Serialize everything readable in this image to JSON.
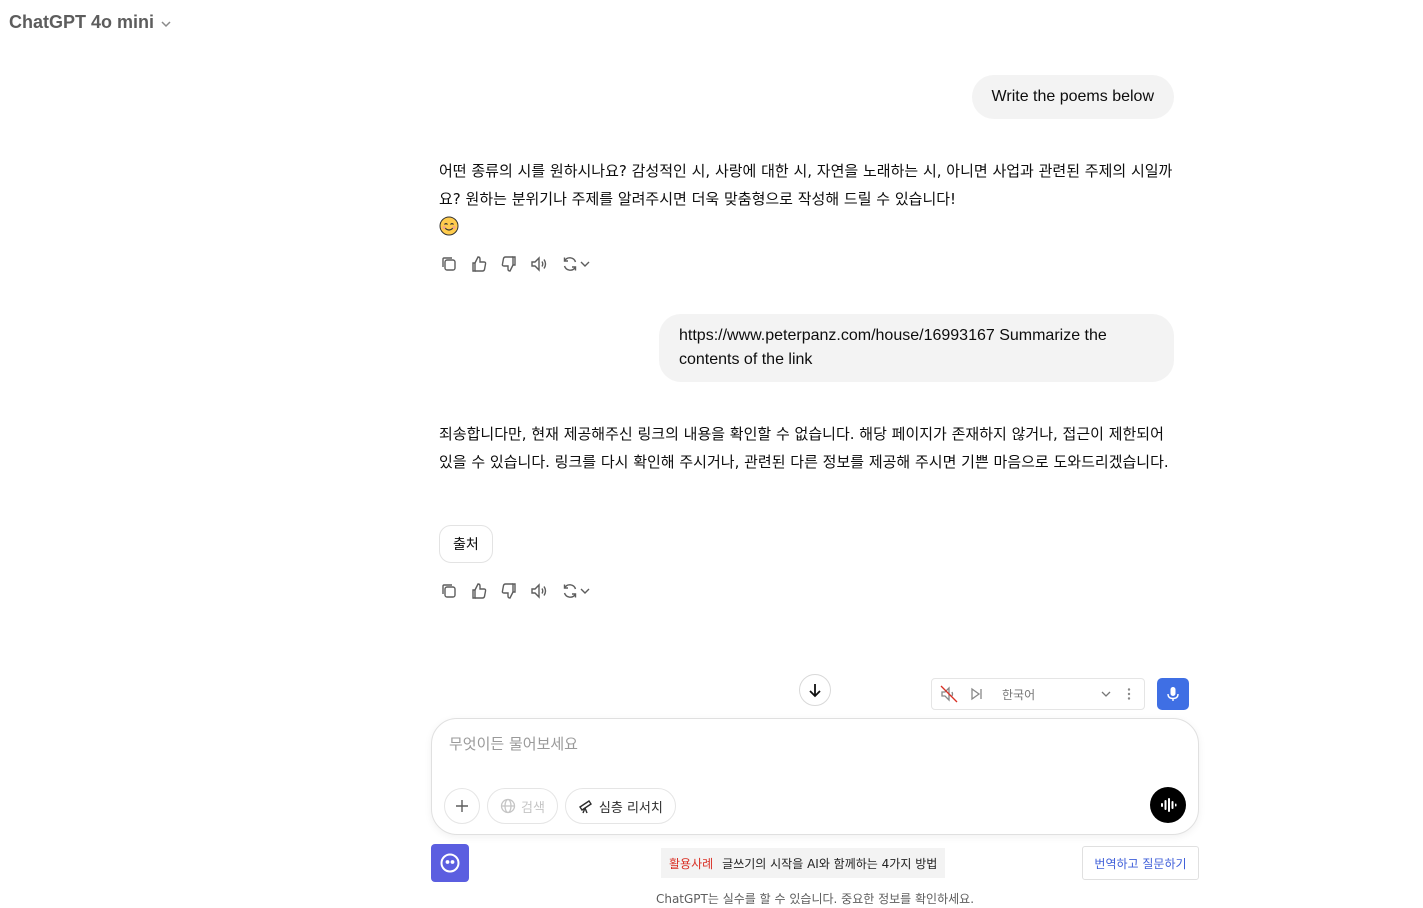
{
  "header": {
    "model_name": "ChatGPT 4o mini"
  },
  "conversation": {
    "user_message_1": "Write the poems below",
    "assistant_message_1": "어떤 종류의 시를 원하시나요? 감성적인 시, 사랑에 대한 시, 자연을 노래하는 시, 아니면 사업과 관련된 주제의 시일까요? 원하는 분위기나 주제를 알려주시면 더욱 맞춤형으로 작성해 드릴 수 있습니다!",
    "assistant_message_1_emoji": "smiling-face-emoji",
    "user_message_2": "https://www.peterpanz.com/house/16993167 Summarize the contents of the link",
    "assistant_message_2": "죄송합니다만, 현재 제공해주신 링크의 내용을 확인할 수 없습니다. 해당 페이지가 존재하지 않거나, 접근이 제한되어 있을 수 있습니다. 링크를 다시 확인해 주시거나, 관련된 다른 정보를 제공해 주시면 기쁜 마음으로 도와드리겠습니다.",
    "sources_label": "출처"
  },
  "voice_bar": {
    "language": "한국어"
  },
  "composer": {
    "placeholder": "무엇이든 물어보세요",
    "search_label": "검색",
    "deep_research_label": "심층 리서치"
  },
  "footer": {
    "usecase_tag": "활용사례",
    "usecase_text": "글쓰기의 시작을 AI와 함께하는 4가지 방법",
    "translate_button": "번역하고 질문하기",
    "disclaimer": "ChatGPT는 실수를 할 수 있습니다. 중요한 정보를 확인하세요."
  },
  "colors": {
    "mic_button": "#3f6fe4",
    "extension_button": "#5b5ee0",
    "usecase_tag": "#d93025",
    "translate_text": "#3f5fd9"
  }
}
